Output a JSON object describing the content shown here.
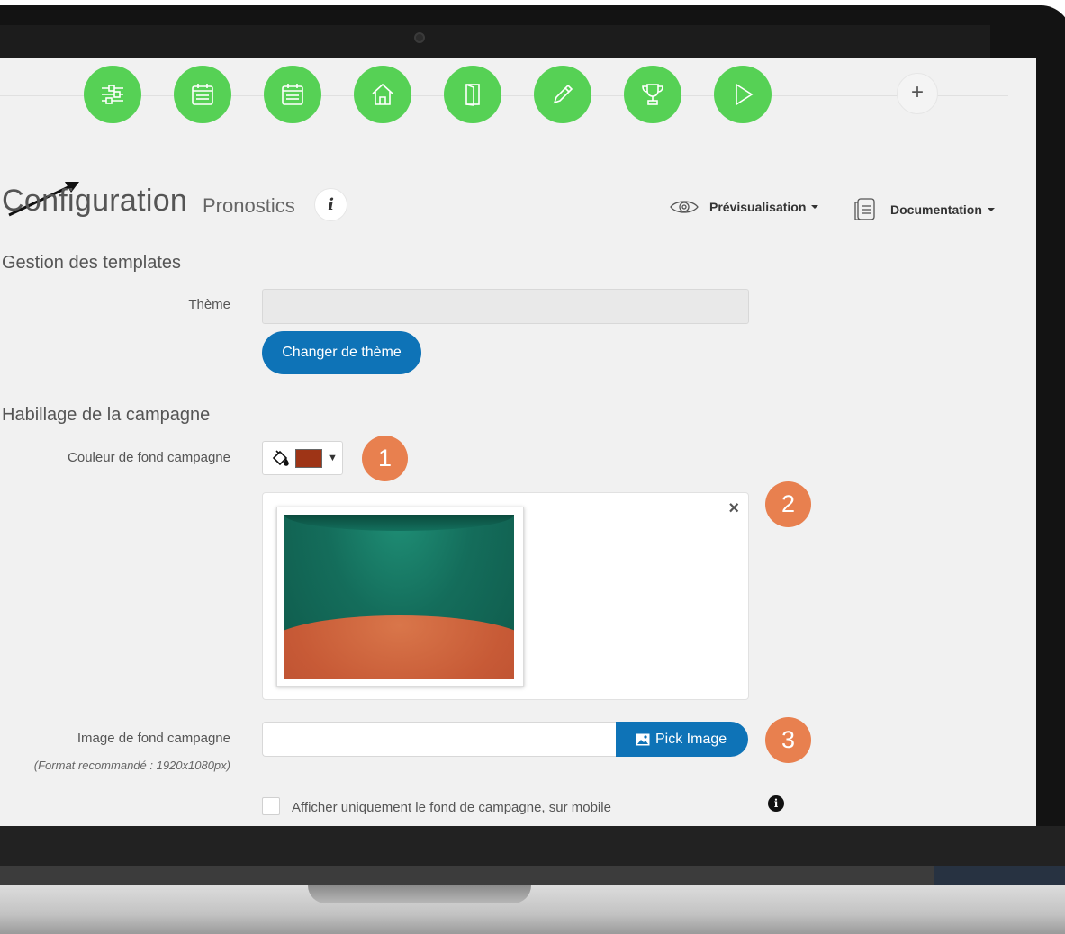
{
  "steps": [
    {
      "icon": "sliders-icon"
    },
    {
      "icon": "calendar-icon"
    },
    {
      "icon": "calendar-icon"
    },
    {
      "icon": "home-icon"
    },
    {
      "icon": "door-icon"
    },
    {
      "icon": "pencil-icon"
    },
    {
      "icon": "trophy-icon"
    },
    {
      "icon": "play-icon"
    }
  ],
  "add_step_label": "+",
  "header": {
    "title": "Configuration",
    "subtitle": "Pronostics",
    "info_label": "i",
    "preview_label": "Prévisualisation",
    "documentation_label": "Documentation"
  },
  "templates": {
    "section_title": "Gestion des templates",
    "theme_label": "Thème",
    "theme_value": "",
    "change_theme_label": "Changer de thème"
  },
  "campaign": {
    "section_title": "Habillage de la campagne",
    "bg_color_label": "Couleur de fond campagne",
    "bg_color": "#9e3416",
    "close_label": "×",
    "bg_image_label": "Image de fond campagne",
    "bg_image_note": "(Format recommandé : 1920x1080px)",
    "bg_image_value": "",
    "pick_image_label": "Pick Image",
    "mobile_only_label": "Afficher uniquement le fond de campagne, sur mobile",
    "mobile_only_checked": false
  },
  "badges": [
    "1",
    "2",
    "3"
  ],
  "colors": {
    "step_green": "#56d155",
    "primary_blue": "#0e73b7",
    "badge_orange": "#e8804f"
  }
}
